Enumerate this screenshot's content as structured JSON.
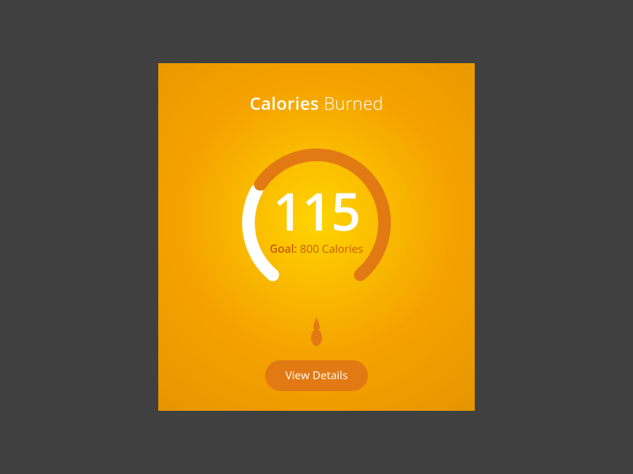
{
  "card": {
    "title_bold": "Calories",
    "title_light": "Burned",
    "value": "115",
    "goal_label": "Goal:",
    "goal_text": "800 Calories",
    "button_label": "View Details",
    "progress_remaining_fraction": 0.72,
    "colors": {
      "track_progress": "#ffffff",
      "track_remaining": "#e27a14",
      "accent": "#e27a14",
      "goal_text": "#c95a00"
    }
  }
}
